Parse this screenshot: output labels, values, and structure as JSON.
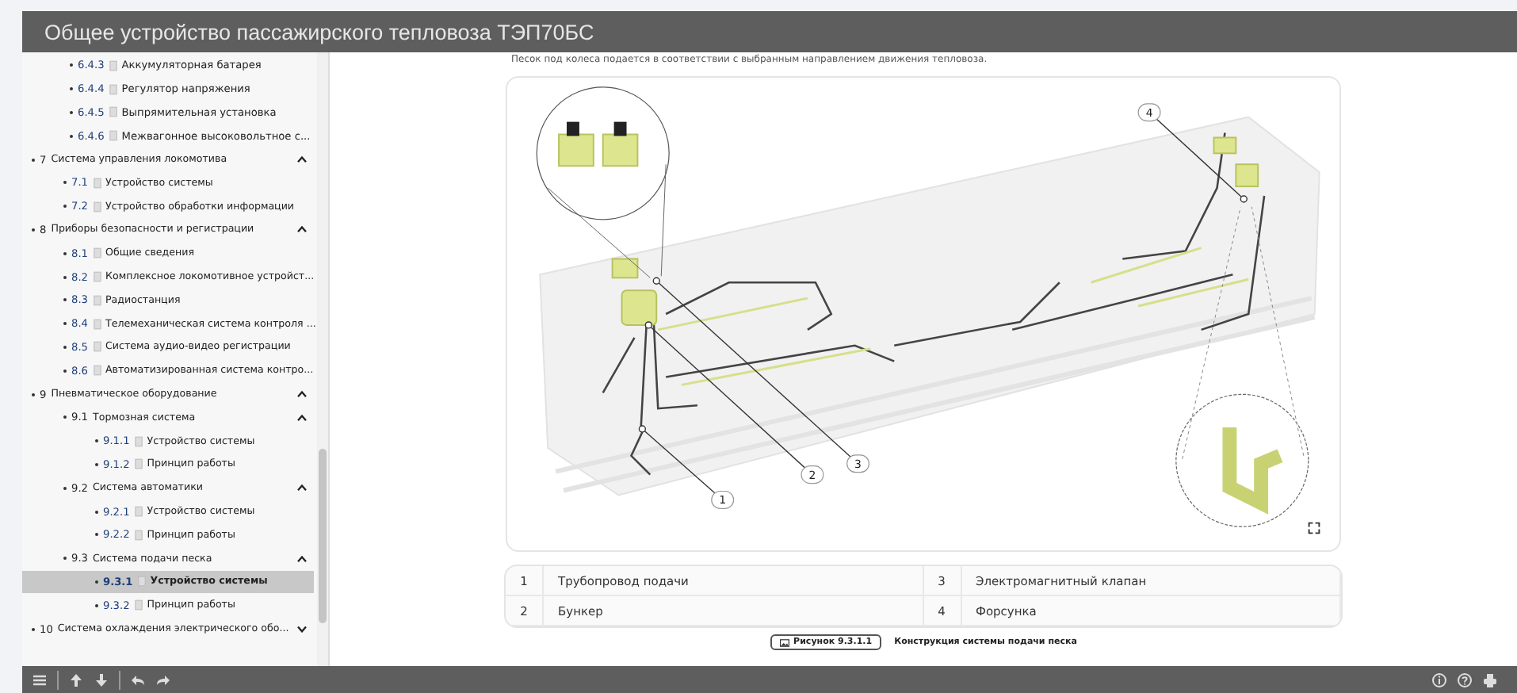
{
  "header": {
    "title": "Общее устройство пассажирского тепловоза ТЭП70БС"
  },
  "sidebar": {
    "partial_items": [
      {
        "number": "6.4.3",
        "title": "Аккумуляторная батарея",
        "selected": false
      },
      {
        "number": "6.4.4",
        "title": "Регулятор напряжения",
        "selected": false
      },
      {
        "number": "6.4.5",
        "title": "Выпрямительная установка",
        "selected": false
      },
      {
        "number": "6.4.6",
        "title": "Межвагонное высоковольтное с...",
        "selected": false
      }
    ],
    "items": [
      {
        "kind": "section",
        "number": "7",
        "title": "Система управления локомотива",
        "expanded": true,
        "selected": false,
        "children": [
          {
            "kind": "page",
            "number": "7.1",
            "title": "Устройство системы",
            "selected": false
          },
          {
            "kind": "page",
            "number": "7.2",
            "title": "Устройство обработки информации",
            "selected": false
          }
        ]
      },
      {
        "kind": "section",
        "number": "8",
        "title": "Приборы безопасности и регистрации",
        "expanded": true,
        "selected": false,
        "children": [
          {
            "kind": "page",
            "number": "8.1",
            "title": "Общие сведения",
            "selected": false
          },
          {
            "kind": "page",
            "number": "8.2",
            "title": "Комплексное локомотивное устройст...",
            "selected": false
          },
          {
            "kind": "page",
            "number": "8.3",
            "title": "Радиостанция",
            "selected": false
          },
          {
            "kind": "page",
            "number": "8.4",
            "title": "Телемеханическая система контроля ...",
            "selected": false
          },
          {
            "kind": "page",
            "number": "8.5",
            "title": "Система аудио-видео регистрации",
            "selected": false
          },
          {
            "kind": "page",
            "number": "8.6",
            "title": "Автоматизированная система контро...",
            "selected": false
          }
        ]
      },
      {
        "kind": "section",
        "number": "9",
        "title": "Пневматическое оборудование",
        "expanded": true,
        "selected": false,
        "children": [
          {
            "kind": "section",
            "number": "9.1",
            "title": "Тормозная система",
            "expanded": true,
            "selected": false,
            "children": [
              {
                "kind": "page",
                "number": "9.1.1",
                "title": "Устройство системы",
                "selected": false
              },
              {
                "kind": "page",
                "number": "9.1.2",
                "title": "Принцип работы",
                "selected": false
              }
            ]
          },
          {
            "kind": "section",
            "number": "9.2",
            "title": "Система автоматики",
            "expanded": true,
            "selected": false,
            "children": [
              {
                "kind": "page",
                "number": "9.2.1",
                "title": "Устройство системы",
                "selected": false
              },
              {
                "kind": "page",
                "number": "9.2.2",
                "title": "Принцип работы",
                "selected": false
              }
            ]
          },
          {
            "kind": "section",
            "number": "9.3",
            "title": "Система подачи песка",
            "expanded": true,
            "selected": false,
            "children": [
              {
                "kind": "page",
                "number": "9.3.1",
                "title": "Устройство системы",
                "selected": true
              },
              {
                "kind": "page",
                "number": "9.3.2",
                "title": "Принцип работы",
                "selected": false
              }
            ]
          }
        ]
      },
      {
        "kind": "section",
        "number": "10",
        "title": "Система охлаждения электрического обо...",
        "expanded": false,
        "selected": false
      }
    ]
  },
  "content": {
    "intro": "Песок под колеса подается в соответствии с выбранным направлением движения тепловоза.",
    "diagram": {
      "callouts": [
        "1",
        "2",
        "3",
        "4"
      ]
    },
    "legend": [
      {
        "number": "1",
        "label": "Трубопровод подачи"
      },
      {
        "number": "2",
        "label": "Бункер"
      },
      {
        "number": "3",
        "label": "Электромагнитный клапан"
      },
      {
        "number": "4",
        "label": "Форсунка"
      }
    ],
    "caption": {
      "figure": "Рисунок 9.3.1.1",
      "text": "Конструкция системы подачи песка"
    }
  }
}
